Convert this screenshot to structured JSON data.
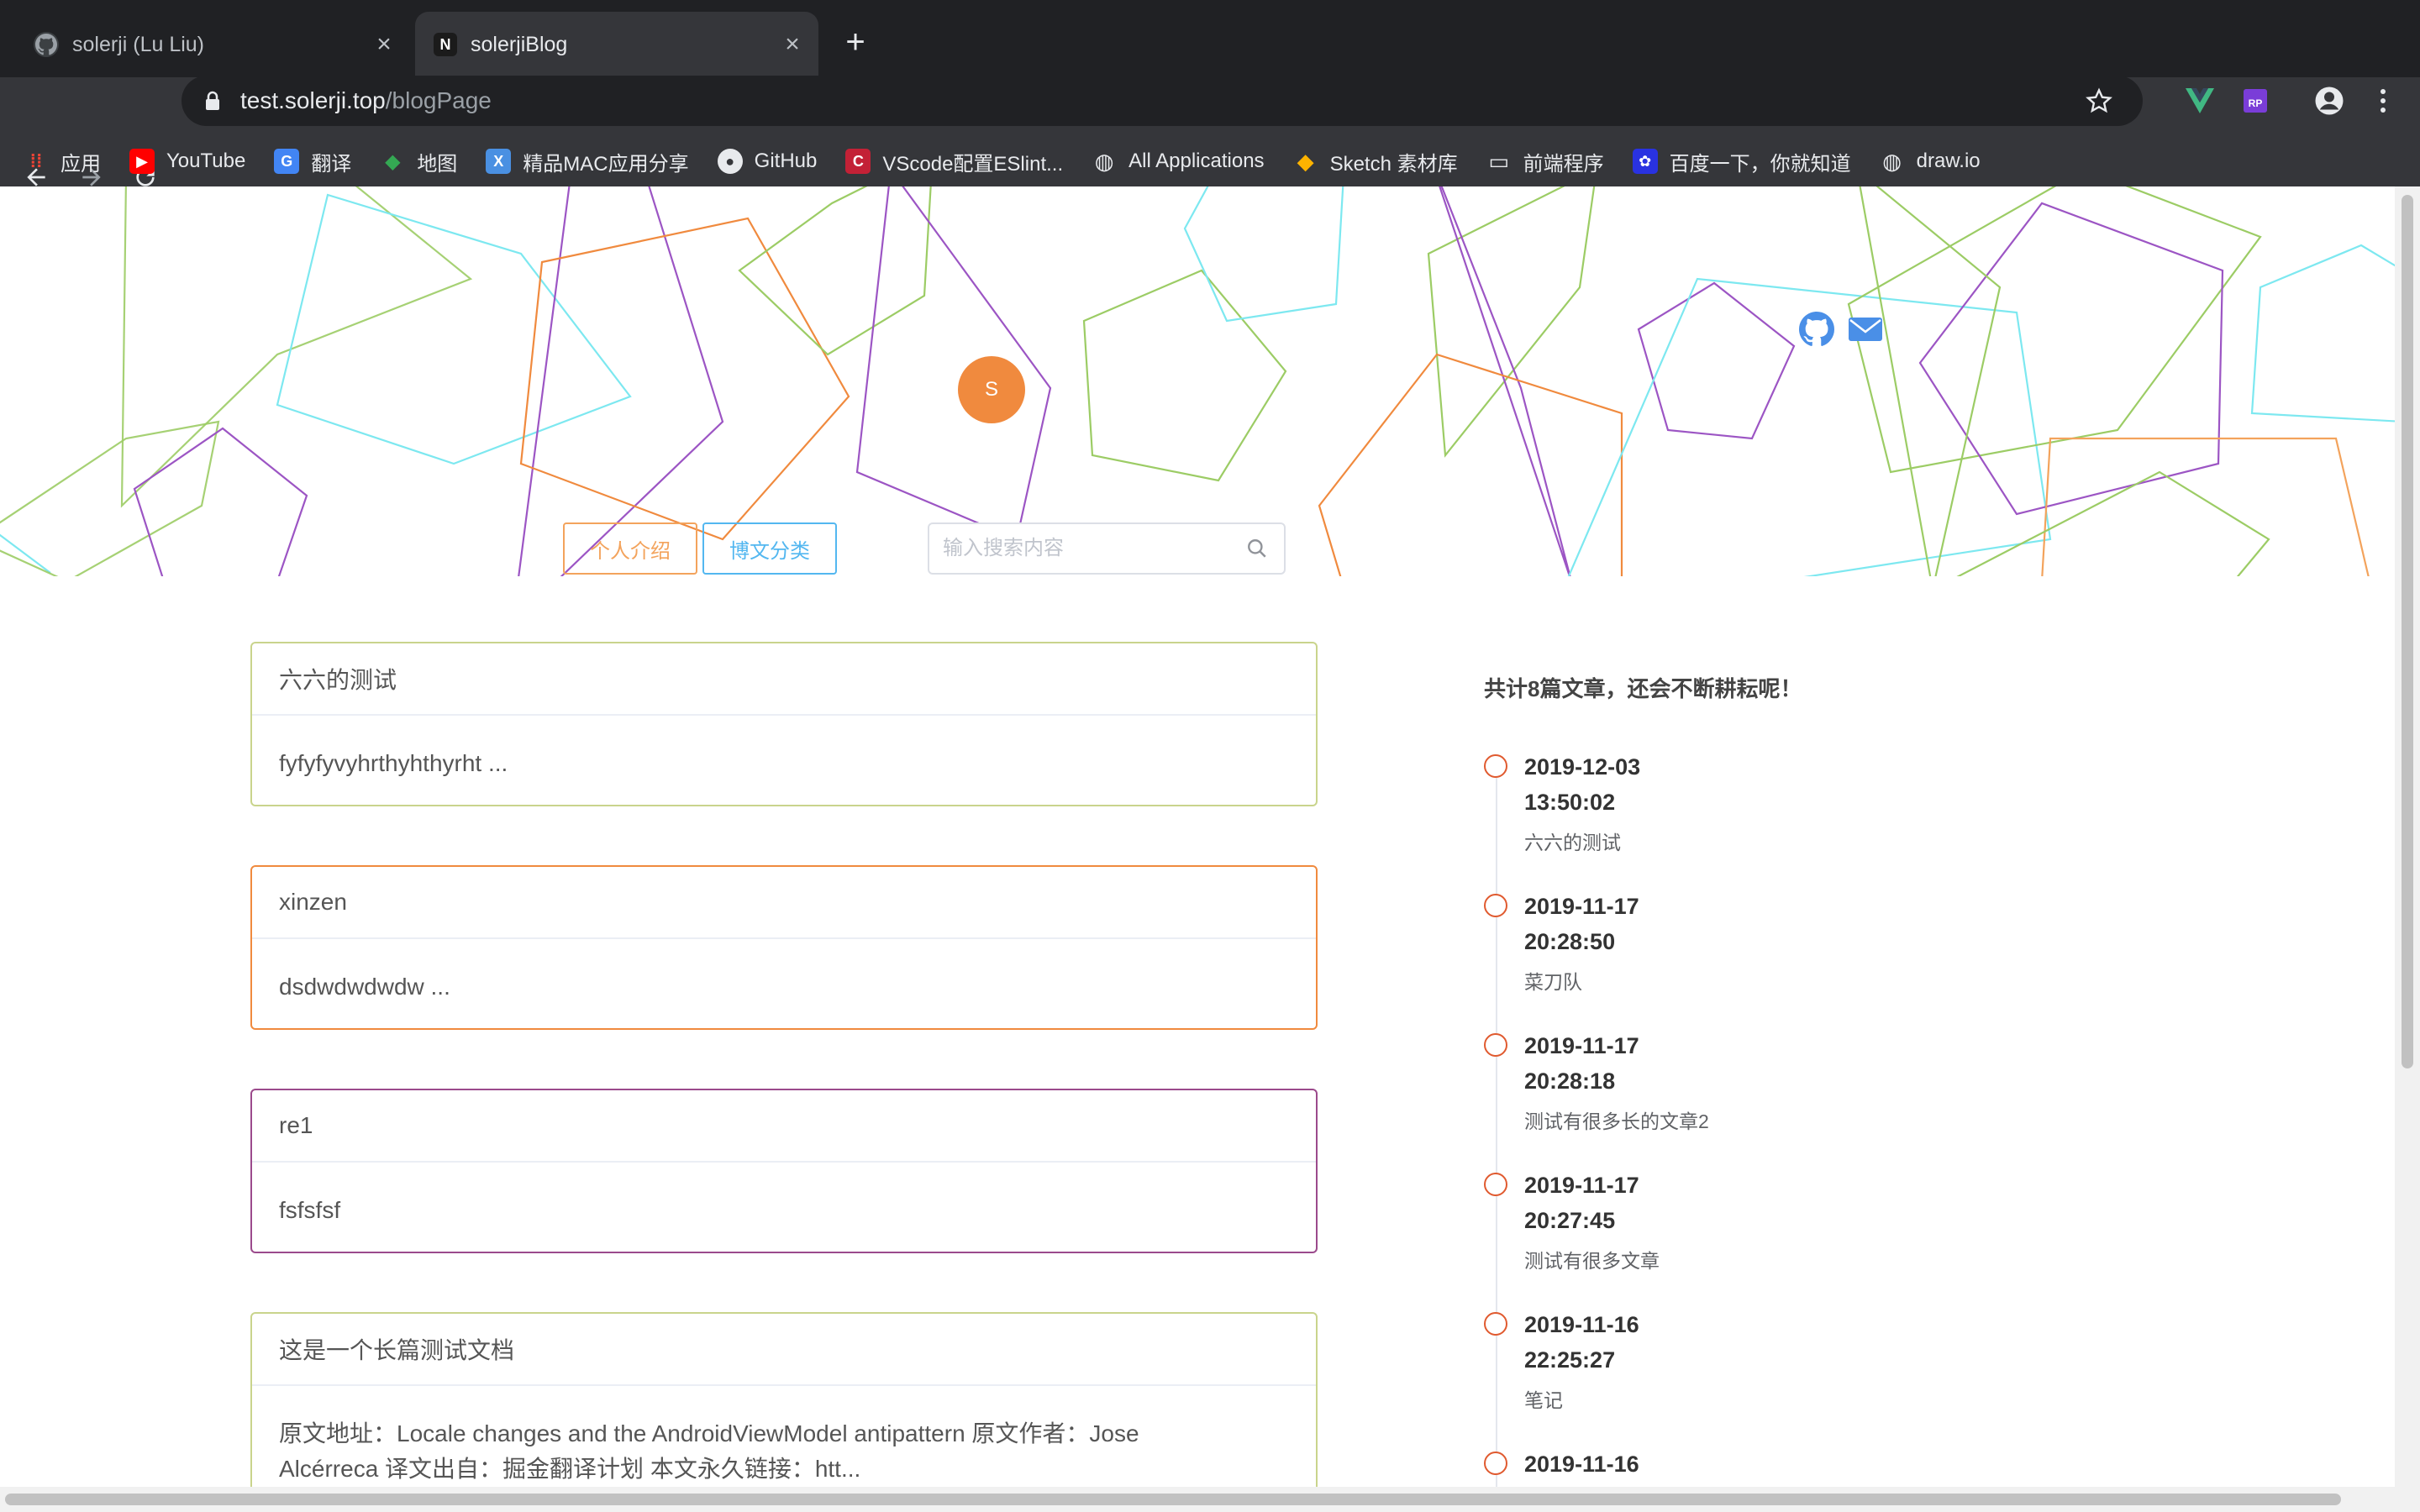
{
  "browser": {
    "tabs": [
      {
        "title": "solerji (Lu Liu)",
        "favicon": "github-icon",
        "active": false
      },
      {
        "title": "solerjiBlog",
        "favicon": "N",
        "active": true
      }
    ],
    "url_host": "test.solerji.top",
    "url_path": "/blogPage",
    "bookmarks": [
      {
        "label": "应用",
        "icon": "apps-grid-icon",
        "color": "#e8eaed"
      },
      {
        "label": "YouTube",
        "icon": "youtube-icon",
        "color": "#ff0000"
      },
      {
        "label": "翻译",
        "icon": "translate-icon",
        "color": "#4285f4"
      },
      {
        "label": "地图",
        "icon": "maps-icon",
        "color": "#34a853"
      },
      {
        "label": "精品MAC应用分享",
        "icon": "xclient-icon",
        "color": "#4a90e2"
      },
      {
        "label": "GitHub",
        "icon": "github-icon",
        "color": "#24292e"
      },
      {
        "label": "VScode配置ESlint...",
        "icon": "csdn-icon",
        "color": "#c32136"
      },
      {
        "label": "All Applications",
        "icon": "globe-icon",
        "color": "#5f6368"
      },
      {
        "label": "Sketch 素材库",
        "icon": "sketch-icon",
        "color": "#fdb300"
      },
      {
        "label": "前端程序",
        "icon": "folder-icon",
        "color": "#9aa0a6"
      },
      {
        "label": "百度一下，你就知道",
        "icon": "baidu-icon",
        "color": "#2932e1"
      },
      {
        "label": "draw.io",
        "icon": "globe-icon",
        "color": "#5f6368"
      }
    ]
  },
  "header": {
    "avatar_letter": "S",
    "nav_intro": "个人介绍",
    "nav_category": "博文分类",
    "search_placeholder": "输入搜索内容"
  },
  "posts": [
    {
      "title": "六六的测试",
      "summary": "fyfyfyvyhrthyhthyrht ...",
      "border": "#c9d48c"
    },
    {
      "title": "xinzen",
      "summary": "dsdwdwdwdw ...",
      "border": "#f08a3e"
    },
    {
      "title": "re1",
      "summary": "fsfsfsf",
      "border": "#9b4a8c"
    },
    {
      "title": "这是一个长篇测试文档",
      "summary": "原文地址：Locale changes and the AndroidViewModel antipattern 原文作者：Jose Alcérreca 译文出自：掘金翻译计划 本文永久链接：htt...",
      "border": "#c9d48c"
    }
  ],
  "timeline": {
    "heading": "共计8篇文章，还会不断耕耘呢！",
    "items": [
      {
        "date": "2019-12-03",
        "time": "13:50:02",
        "title": "六六的测试"
      },
      {
        "date": "2019-11-17",
        "time": "20:28:50",
        "title": "菜刀队"
      },
      {
        "date": "2019-11-17",
        "time": "20:28:18",
        "title": "测试有很多长的文章2"
      },
      {
        "date": "2019-11-17",
        "time": "20:27:45",
        "title": "测试有很多文章"
      },
      {
        "date": "2019-11-16",
        "time": "22:25:27",
        "title": "笔记"
      },
      {
        "date": "2019-11-16",
        "time": "",
        "title": ""
      }
    ]
  },
  "colors": {
    "accent_orange": "#f08a3e",
    "accent_blue": "#53b7f0",
    "timeline_dot": "#e05a2f"
  }
}
